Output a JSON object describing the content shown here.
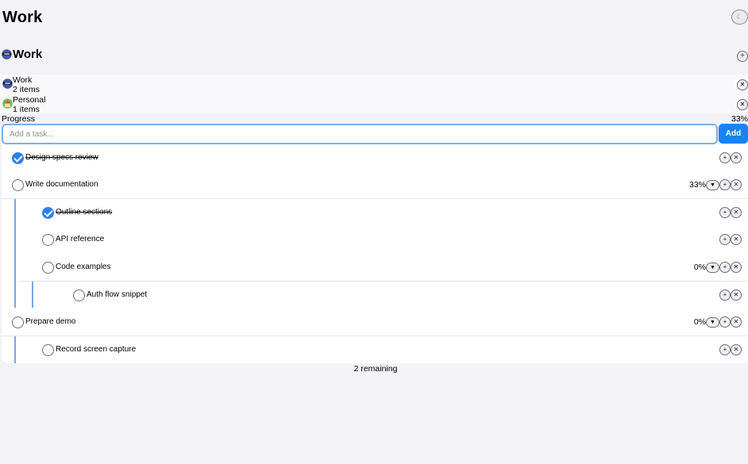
{
  "header": {
    "title": "Work",
    "theme_icon": "moon-icon"
  },
  "current_list": {
    "emoji": "ninja-emoji",
    "name": "Work",
    "add_icon": "plus-icon"
  },
  "lists": [
    {
      "emoji": "ninja-emoji",
      "name": "Work",
      "count": "2 items"
    },
    {
      "emoji": "house-emoji",
      "name": "Personal",
      "count": "1 items"
    }
  ],
  "progress": {
    "label": "Progress",
    "value": "33%"
  },
  "add_task": {
    "placeholder": "Add a task...",
    "button_label": "Add"
  },
  "tasks": [
    {
      "text": "Design specs review",
      "done": true
    },
    {
      "text": "Write documentation",
      "done": false,
      "percent": "33%"
    },
    {
      "text": "Outline sections",
      "done": true
    },
    {
      "text": "API reference",
      "done": false
    },
    {
      "text": "Code examples",
      "done": false,
      "percent": "0%"
    },
    {
      "text": "Auth flow snippet",
      "done": false
    },
    {
      "text": "Prepare demo",
      "done": false,
      "percent": "0%"
    },
    {
      "text": "Record screen capture",
      "done": false
    }
  ],
  "footer": {
    "remaining": "2 remaining"
  },
  "colors": {
    "accent": "#1a82f7",
    "check": "#2f80ed",
    "nest_line": "#7ba7e8",
    "background": "#f2f2f7"
  }
}
